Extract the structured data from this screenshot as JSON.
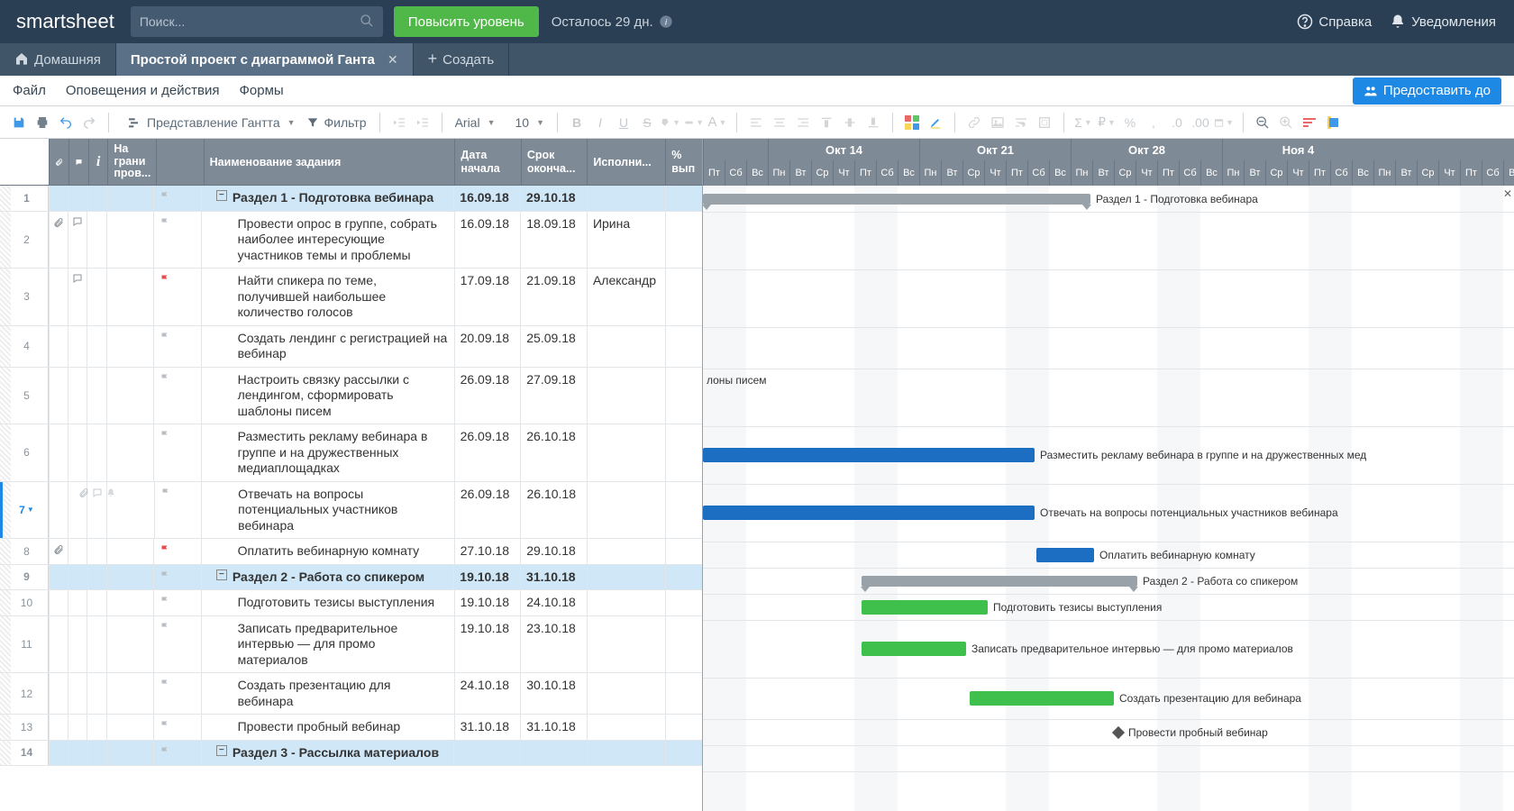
{
  "header": {
    "logo": "smartsheet",
    "search_placeholder": "Поиск...",
    "upgrade": "Повысить уровень",
    "trial": "Осталось 29 дн.",
    "help": "Справка",
    "notif": "Уведомления"
  },
  "tabs": {
    "home": "Домашняя",
    "active": "Простой проект с диаграммой Ганта",
    "create": "Создать"
  },
  "menu": {
    "file": "Файл",
    "alerts": "Оповещения и действия",
    "forms": "Формы",
    "share": "Предоставить до"
  },
  "toolbar": {
    "view": "Представление Гантта",
    "filter": "Фильтр",
    "font": "Arial",
    "size": "10"
  },
  "columns": {
    "flag": "На грани пров...",
    "name": "Наименование задания",
    "start": "Дата начала",
    "end": "Срок оконча...",
    "asg": "Исполни...",
    "pct": "% вып"
  },
  "weeks": [
    "Окт 14",
    "Окт 21",
    "Окт 28",
    "Ноя 4"
  ],
  "daylabels": [
    "Пт",
    "Сб",
    "Вс",
    "Пн",
    "Вт",
    "Ср",
    "Чт"
  ],
  "rows": [
    {
      "n": "1",
      "section": true,
      "flag": "gray",
      "name": "Раздел 1 - Подготовка вебинара",
      "start": "16.09.18",
      "end": "29.10.18"
    },
    {
      "n": "2",
      "flag": "gray",
      "att": true,
      "cmt": true,
      "name": "Провести опрос в группе, собрать наиболее интересующие участников темы и проблемы",
      "start": "16.09.18",
      "end": "18.09.18",
      "asg": "Ирина"
    },
    {
      "n": "3",
      "flag": "red",
      "cmt": true,
      "name": "Найти спикера по теме, получившей наибольшее количество голосов",
      "start": "17.09.18",
      "end": "21.09.18",
      "asg": "Александр"
    },
    {
      "n": "4",
      "flag": "gray",
      "name": "Создать лендинг с регистрацией на вебинар",
      "start": "20.09.18",
      "end": "25.09.18"
    },
    {
      "n": "5",
      "flag": "gray",
      "name": "Настроить связку рассылки с лендингом, сформировать шаблоны писем",
      "start": "26.09.18",
      "end": "27.09.18"
    },
    {
      "n": "6",
      "flag": "gray",
      "name": "Разместить рекламу вебинара в группе и на дружественных медиаплощадках",
      "start": "26.09.18",
      "end": "26.10.18"
    },
    {
      "n": "7",
      "flag": "gray",
      "name": "Отвечать на вопросы потенциальных участников вебинара",
      "start": "26.09.18",
      "end": "26.10.18",
      "active": true
    },
    {
      "n": "8",
      "flag": "red",
      "att": true,
      "name": "Оплатить вебинарную комнату",
      "start": "27.10.18",
      "end": "29.10.18"
    },
    {
      "n": "9",
      "section": true,
      "flag": "gray",
      "name": "Раздел 2 - Работа со спикером",
      "start": "19.10.18",
      "end": "31.10.18"
    },
    {
      "n": "10",
      "flag": "gray",
      "name": "Подготовить тезисы выступления",
      "start": "19.10.18",
      "end": "24.10.18"
    },
    {
      "n": "11",
      "flag": "gray",
      "name": "Записать предварительное интервью — для промо материалов",
      "start": "19.10.18",
      "end": "23.10.18"
    },
    {
      "n": "12",
      "flag": "gray",
      "name": "Создать презентацию для вебинара",
      "start": "24.10.18",
      "end": "30.10.18"
    },
    {
      "n": "13",
      "flag": "gray",
      "name": "Провести пробный вебинар",
      "start": "31.10.18",
      "end": "31.10.18"
    },
    {
      "n": "14",
      "section": true,
      "flag": "gray",
      "name": "Раздел 3 - Рассылка материалов"
    }
  ],
  "gantt": {
    "labels": {
      "r1": "Раздел 1 - Подготовка вебинара",
      "r5": "лоны писем",
      "r6": "Разместить рекламу вебинара в группе и на дружественных мед",
      "r7": "Отвечать на вопросы потенциальных участников вебинара",
      "r8": "Оплатить вебинарную комнату",
      "r9": "Раздел 2 - Работа со спикером",
      "r10": "Подготовить тезисы выступления",
      "r11": "Записать предварительное интервью — для промо материалов",
      "r12": "Создать презентацию для вебинара",
      "r13": "Провести пробный вебинар"
    }
  }
}
